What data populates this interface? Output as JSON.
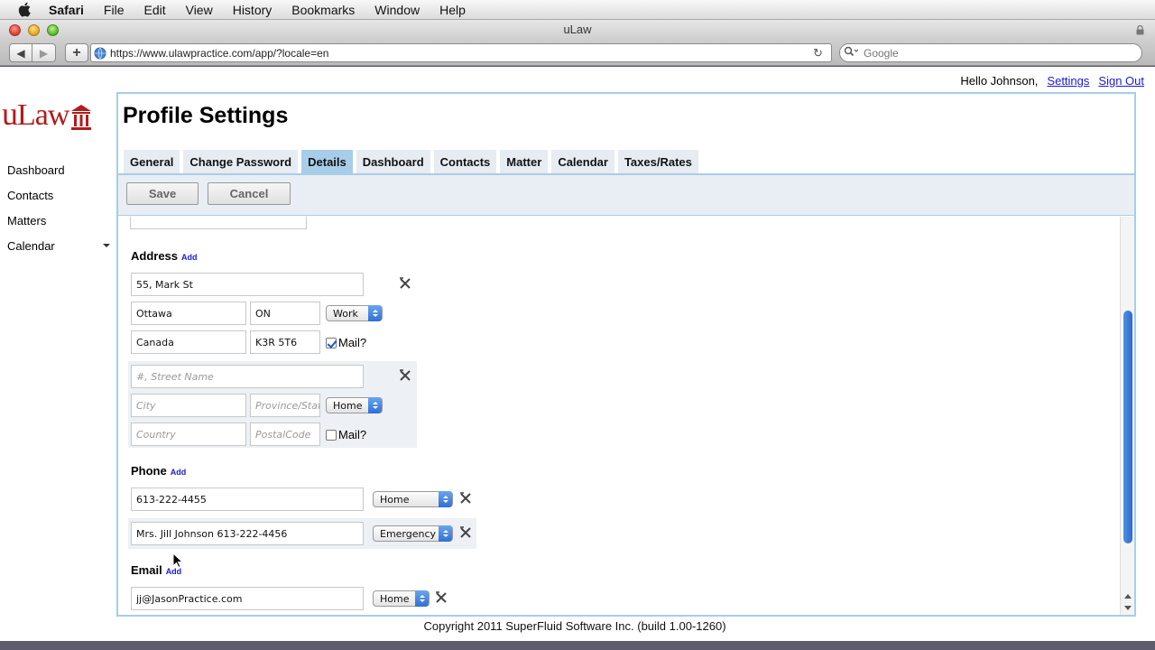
{
  "menubar": {
    "items": [
      "Safari",
      "File",
      "Edit",
      "View",
      "History",
      "Bookmarks",
      "Window",
      "Help"
    ]
  },
  "browser": {
    "window_title": "uLaw",
    "url": "https://www.ulawpractice.com/app/?locale=en",
    "search_placeholder": "Google"
  },
  "header": {
    "greeting": "Hello Johnson,",
    "settings_link": "Settings",
    "signout_link": "Sign Out"
  },
  "logo": {
    "text": "Law",
    "first_letter": "u"
  },
  "sidebar": {
    "items": [
      {
        "label": "Dashboard"
      },
      {
        "label": "Contacts"
      },
      {
        "label": "Matters"
      },
      {
        "label": "Calendar"
      }
    ]
  },
  "main": {
    "title": "Profile Settings",
    "tabs": [
      {
        "label": "General",
        "active": false
      },
      {
        "label": "Change Password",
        "active": false
      },
      {
        "label": "Details",
        "active": true
      },
      {
        "label": "Dashboard",
        "active": false
      },
      {
        "label": "Contacts",
        "active": false
      },
      {
        "label": "Matter",
        "active": false
      },
      {
        "label": "Calendar",
        "active": false
      },
      {
        "label": "Taxes/Rates",
        "active": false
      }
    ],
    "save_label": "Save",
    "cancel_label": "Cancel"
  },
  "address": {
    "label": "Address",
    "add_label": "Add",
    "entries": [
      {
        "street": "55, Mark St",
        "city": "Ottawa",
        "province": "ON",
        "type": "Work",
        "country": "Canada",
        "postal": "K3R 5T6",
        "mail_label": "Mail?",
        "mail": true
      },
      {
        "street_ph": "#, Street Name",
        "city_ph": "City",
        "province_ph": "Province/State",
        "type": "Home",
        "country_ph": "Country",
        "postal_ph": "PostalCode",
        "mail_label": "Mail?",
        "mail": false
      }
    ]
  },
  "phone": {
    "label": "Phone",
    "add_label": "Add",
    "entries": [
      {
        "value": "613-222-4455",
        "type": "Home"
      },
      {
        "value": "Mrs. Jill Johnson 613-222-4456",
        "type": "Emergency"
      }
    ]
  },
  "email": {
    "label": "Email",
    "add_label": "Add",
    "entries": [
      {
        "value": "jj@JasonPractice.com",
        "type": "Home"
      }
    ]
  },
  "footer": {
    "copyright": "Copyright 2011 SuperFluid Software Inc. (build 1.00-1260)"
  },
  "colors": {
    "brand": "#b21c1c",
    "tab_active": "#a8cde9",
    "link": "#1a1ad8",
    "scroll_thumb": "#2a6bd0"
  }
}
